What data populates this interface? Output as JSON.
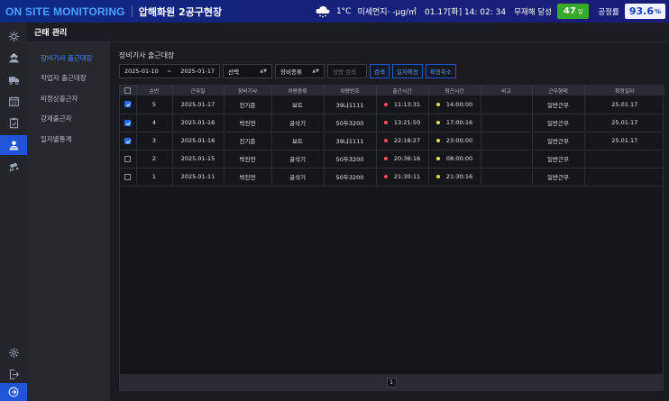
{
  "header": {
    "brand": "ON SITE MONITORING",
    "site_name": "압해화원 2공구현장",
    "temperature": "1°C",
    "fine_dust": "미세먼지· -μg/㎥",
    "datetime": "01.17[화] 14: 02: 34",
    "no_accident_label": "무재해 달성",
    "no_accident_days": "47",
    "no_accident_unit": "일",
    "progress_label": "공정률",
    "progress_value": "93.6",
    "progress_unit": "%"
  },
  "colors": {
    "accent": "#1f55d6",
    "brand": "#49a3ff",
    "badge_green": "#38a82a"
  },
  "rail": {
    "icons": [
      "dashboard-icon",
      "workers-icon",
      "truck-icon",
      "calendar-icon",
      "checklist-icon",
      "attendance-icon",
      "cctv-icon"
    ],
    "bottom_icons": [
      "settings-icon",
      "logout-icon",
      "next-icon"
    ]
  },
  "section": {
    "title": "근태 관리"
  },
  "submenu": {
    "items": [
      {
        "label": "장비기사 출근대장",
        "active": true
      },
      {
        "label": "작업자 출근대장",
        "active": false
      },
      {
        "label": "비정상출근자",
        "active": false
      },
      {
        "label": "강제출근자",
        "active": false
      },
      {
        "label": "일자별통계",
        "active": false
      }
    ]
  },
  "page": {
    "title": "장비기사 출근대장",
    "start_date": "2025-01-10",
    "date_sep": "~",
    "end_date": "2025-01-17",
    "select1": "선택",
    "select2": "장비종류",
    "search_placeholder": "성명 검색",
    "btn_search": "검색",
    "btn_confirm": "일자확정",
    "btn_cancel": "확정취소"
  },
  "table": {
    "columns": [
      "",
      "순번",
      "근무일",
      "장비기사",
      "차량종류",
      "차량번호",
      "출근시간",
      "퇴근시간",
      "비고",
      "근무형태",
      "확정일자"
    ],
    "rows": [
      {
        "checked": true,
        "no": "5",
        "date": "2025.01-17",
        "driver": "진기준",
        "vehicle_type": "보트",
        "vehicle_no": "39나1111",
        "in_time": "11:13:31",
        "out_time": "14:00:00",
        "note": "",
        "work_type": "일반근무",
        "confirm_date": "25.01.17"
      },
      {
        "checked": true,
        "no": "4",
        "date": "2025.01-16",
        "driver": "박진언",
        "vehicle_type": "굴삭기",
        "vehicle_no": "50두3200",
        "in_time": "13:21:50",
        "out_time": "17:00:16",
        "note": "",
        "work_type": "일반근무",
        "confirm_date": "25.01.17"
      },
      {
        "checked": true,
        "no": "3",
        "date": "2025.01-16",
        "driver": "진기준",
        "vehicle_type": "보트",
        "vehicle_no": "39나1111",
        "in_time": "22:18:27",
        "out_time": "23:00:00",
        "note": "",
        "work_type": "일반근무",
        "confirm_date": "25.01.17"
      },
      {
        "checked": false,
        "no": "2",
        "date": "2025.01-15",
        "driver": "박진언",
        "vehicle_type": "굴삭기",
        "vehicle_no": "50두3200",
        "in_time": "20:36:16",
        "out_time": "08:00:00",
        "note": "",
        "work_type": "일반근무",
        "confirm_date": ""
      },
      {
        "checked": false,
        "no": "1",
        "date": "2025.01-11",
        "driver": "박진언",
        "vehicle_type": "굴삭기",
        "vehicle_no": "50두3200",
        "in_time": "21:30:11",
        "out_time": "21:30:16",
        "note": "",
        "work_type": "일반근무",
        "confirm_date": ""
      }
    ]
  },
  "pagination": {
    "current": "1"
  }
}
